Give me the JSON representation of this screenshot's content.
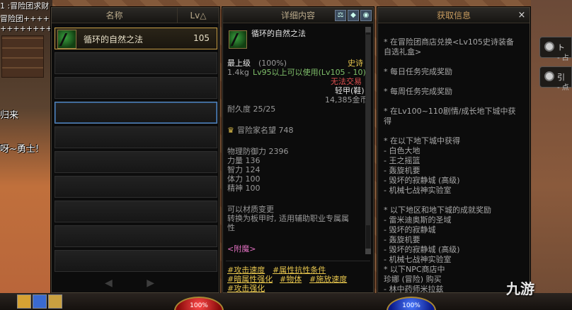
{
  "background": {
    "guild_rows": [
      "1 :冒险团求财",
      "冒险团+++++",
      "+++++++++++"
    ],
    "speech1": "归来",
    "speech2": "呀~勇士!",
    "side_buttons": [
      {
        "title": "ト",
        "sub": "- 占"
      },
      {
        "title": "引",
        "sub": "- 点"
      }
    ]
  },
  "list_window": {
    "col_name": "名称",
    "col_lv": "Lv△",
    "items": [
      {
        "name": "循环的自然之法",
        "lv": "105"
      }
    ],
    "pager_prev": "◀",
    "pager_next": "▶"
  },
  "detail_window": {
    "title": "详细内容",
    "item_name": "循环的自然之法",
    "grade": "最上级",
    "grade_pct": "(100%)",
    "rarity": "史诗",
    "weight": "1.4kg",
    "req": "Lv95以上可以使用(Lv105 - 10)",
    "trade": "无法交易",
    "type": "轻甲(鞋)",
    "price": "14,385金币",
    "durability": "耐久度 25/25",
    "reputation": "冒险家名望 748",
    "stats": [
      "物理防御力 2396",
      "力量 136",
      "智力 124",
      "体力 100",
      "精神 100"
    ],
    "note1": "可以材质变更",
    "note2": "转换为板甲时, 适用辅助职业专属属",
    "note3": "性",
    "enchant_label": "<附魔>",
    "tags": [
      "#攻击速度",
      "#属性抗性条件",
      "#暗属性强化",
      "#物体",
      "#施放速度",
      "#攻击强化"
    ]
  },
  "obtain_window": {
    "title": "获取信息",
    "close": "×",
    "lines": [
      "* 在冒险团商店兑换<Lv105史诗装备",
      "自选礼盒>",
      "* 每日任务完成奖励",
      "* 每周任务完成奖励",
      "* 在Lv100~110剧情/成长地下城中获",
      "得",
      "* 在以下地下城中获得",
      "- 白色大地",
      "- 王之摇篮",
      "- 轰旋机要",
      "- 毁坏的寂静城 (高级)",
      "- 机械七战神实验室",
      "* 以下地区和地下城的成就奖励",
      "- 雷米迪奥斯的圣域",
      "- 毁坏的寂静城",
      "- 轰旋机要",
      "- 毁坏的寂静城 (高级)",
      "- 机械七战神实验室",
      "* 以下NPC商店中",
      "珍娜 (冒险) 购买",
      "- 林中药师米拉兹"
    ]
  },
  "bottom": {
    "hp": "100%",
    "mp": "100%",
    "mp_right": "100%",
    "watermark": "九游"
  }
}
